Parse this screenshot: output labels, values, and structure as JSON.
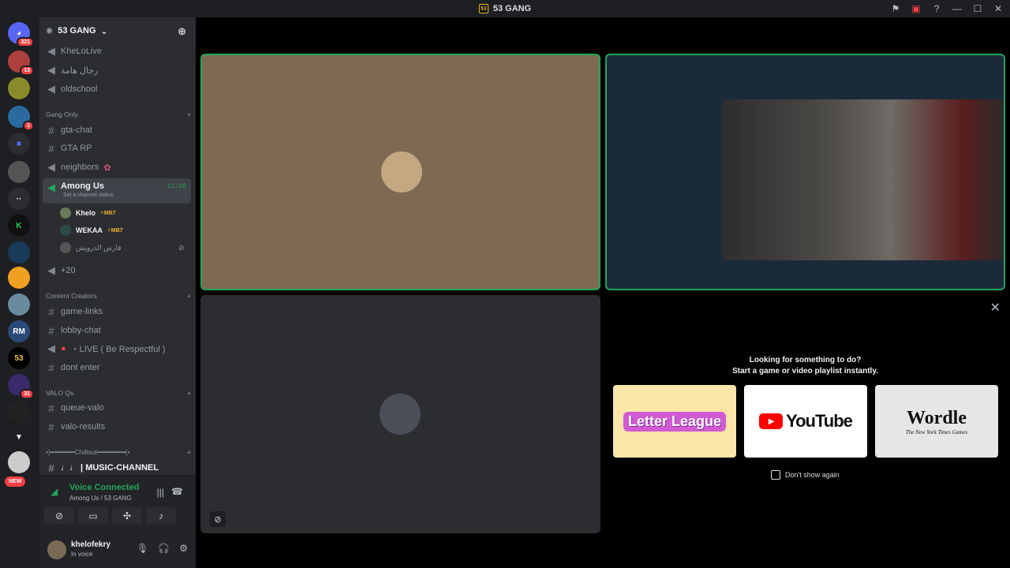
{
  "window": {
    "title": "53 GANG"
  },
  "server": {
    "name": "53 GANG"
  },
  "guild_badges": {
    "home": "321",
    "g1": "13",
    "g3": "1",
    "g13": "31",
    "new": "NEW"
  },
  "channels": {
    "top": [
      "KheLoLive",
      "رجال هامة",
      "oldschool"
    ],
    "cat_gang": "Gang Only.",
    "gang": [
      "gta-chat",
      "GTA RP",
      "neighbors"
    ],
    "active": {
      "label": "Among Us",
      "sub": "Set a channel status",
      "time": "11:36"
    },
    "voice_users": [
      {
        "name": "Khelo",
        "tag": "⚡MB7"
      },
      {
        "name": "WEKAA",
        "tag": "⚡MB7"
      },
      {
        "name": "فارس الدرويش",
        "tag": ""
      }
    ],
    "plus": "+20",
    "cat_creators": "Content Creators",
    "creators": [
      "game-links",
      "lobby-chat",
      "・LIVE ( Be Respectful )",
      "dont enter"
    ],
    "cat_valo": "VALO Qs",
    "valo": [
      "queue-valo",
      "valo-results"
    ],
    "cat_chill": "•)━━━━━━Chillout━━━━━━━(•",
    "music": "♩♩ | MUSIC-CHANNEL"
  },
  "voice": {
    "status": "Voice Connected",
    "location": "Among Us / 53 GANG"
  },
  "user": {
    "name": "khelofekry",
    "status": "In voice"
  },
  "activity": {
    "line1": "Looking for something to do?",
    "line2": "Start a game or video playlist instantly.",
    "cards": [
      "Letter League",
      "YouTube",
      "Wordle"
    ],
    "wordle_sub": "The New York Times Games",
    "dont_show": "Don't show again"
  },
  "colors": {
    "accent_green": "#23a55a",
    "sidebar": "#2b2d31",
    "rail": "#1e1f22"
  }
}
